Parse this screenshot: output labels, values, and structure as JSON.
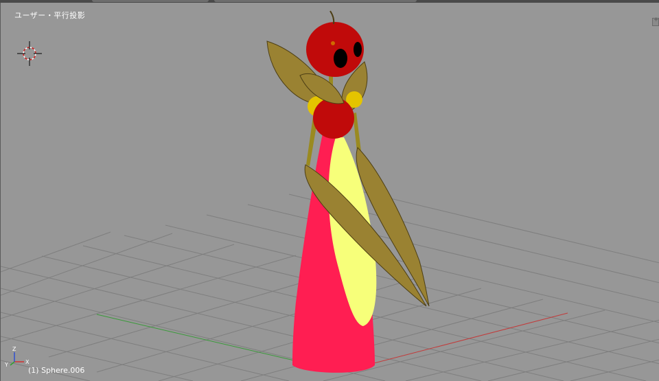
{
  "viewport": {
    "view_label": "ユーザー・平行投影",
    "object_label": "(1) Sphere.006"
  },
  "axes": {
    "x": "X",
    "y": "Y",
    "z": "Z"
  },
  "colors": {
    "background": "#979797",
    "grid": "#7e7e7e",
    "x_axis": "#c23b3b",
    "y_axis": "#3a9a3a",
    "body": "#ff1e52",
    "apron": "#f7ff7a",
    "apple": "#c00a0a",
    "leaf": "#9a8232",
    "ball": "#e4c400"
  },
  "icons": [
    "3d-cursor-icon",
    "axis-gizmo-icon",
    "view-corner-widget-icon"
  ]
}
